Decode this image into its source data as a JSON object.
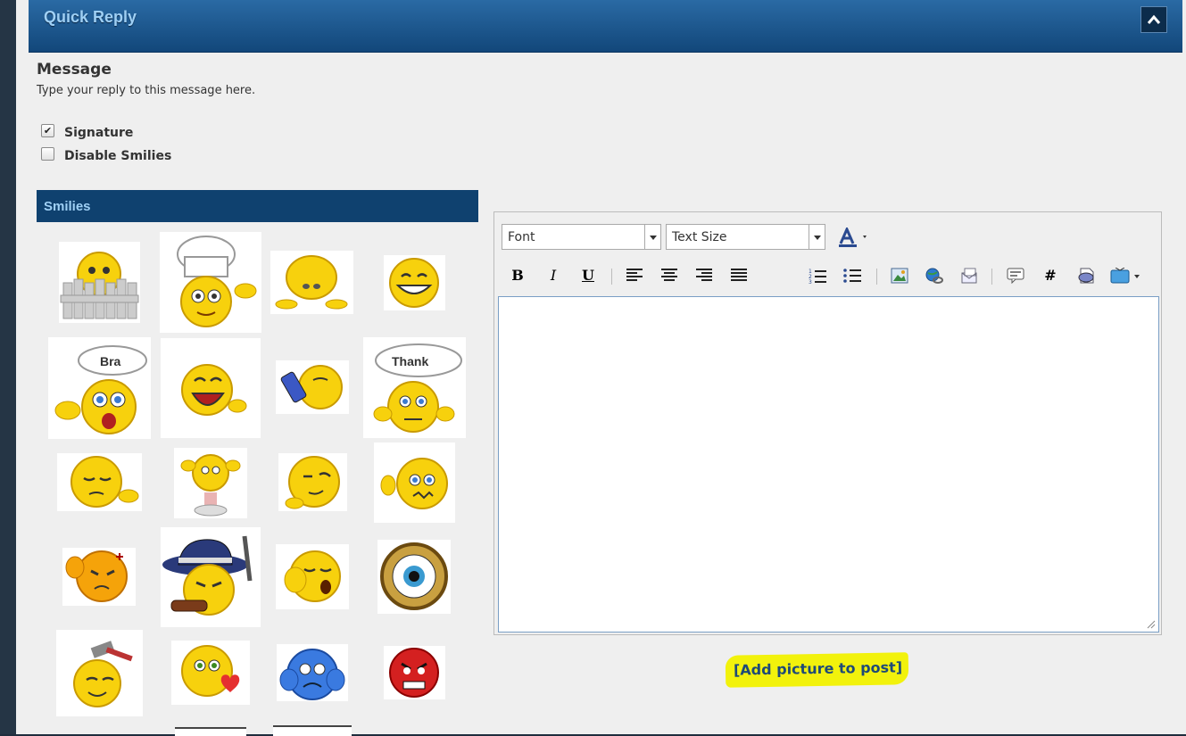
{
  "header": {
    "title": "Quick Reply"
  },
  "message": {
    "title": "Message",
    "hint": "Type your reply to this message here."
  },
  "options": {
    "signature_label": "Signature",
    "signature_checked": true,
    "disable_smilies_label": "Disable Smilies",
    "disable_smilies_checked": false
  },
  "smilies": {
    "title": "Smilies",
    "items": [
      {
        "icon": "smiley-fence-icon"
      },
      {
        "icon": "smiley-chef-icon",
        "text": ""
      },
      {
        "icon": "smiley-crawling-icon"
      },
      {
        "icon": "smiley-grin-icon"
      },
      {
        "icon": "smiley-bra-icon",
        "text": "Bra"
      },
      {
        "icon": "smiley-laughing-icon"
      },
      {
        "icon": "smiley-drinking-icon"
      },
      {
        "icon": "smiley-thank-icon",
        "text": "Thank"
      },
      {
        "icon": "smiley-sleepy-icon"
      },
      {
        "icon": "smiley-thinking-icon"
      },
      {
        "icon": "smiley-smug-icon"
      },
      {
        "icon": "smiley-thumbs-down-icon"
      },
      {
        "icon": "smiley-angry-thumb-icon"
      },
      {
        "icon": "smiley-gangster-icon"
      },
      {
        "icon": "smiley-yawn-icon"
      },
      {
        "icon": "smiley-eye-icon"
      },
      {
        "icon": "smiley-hammer-icon"
      },
      {
        "icon": "smiley-love-icon"
      },
      {
        "icon": "smiley-sad-blue-icon"
      },
      {
        "icon": "smiley-mad-red-icon"
      }
    ]
  },
  "editor": {
    "font_select": "Font",
    "size_select": "Text Size",
    "toolbar": [
      "text-color-icon",
      "bold-icon",
      "italic-icon",
      "underline-icon",
      "align-left-icon",
      "align-center-icon",
      "align-right-icon",
      "justify-icon",
      "ordered-list-icon",
      "unordered-list-icon",
      "insert-image-icon",
      "insert-link-icon",
      "unlink-icon",
      "quote-icon",
      "hashtag-icon",
      "php-code-icon",
      "video-icon"
    ],
    "bold_label": "B",
    "italic_label": "I",
    "underline_label": "U",
    "hashtag_label": "#",
    "text_value": ""
  },
  "add_picture_label": "[Add picture to post]",
  "colors": {
    "header": "#12477a",
    "header_text": "#9fd0f5",
    "highlight": "#f2f20c",
    "link": "#1e4a78"
  }
}
